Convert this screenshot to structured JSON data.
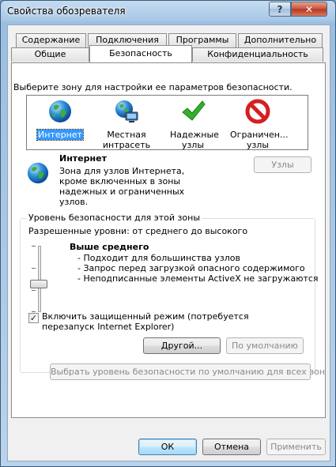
{
  "window": {
    "title": "Свойства обозревателя",
    "help_glyph": "?",
    "close_glyph": "✕"
  },
  "tabs": [
    {
      "label": "Содержание"
    },
    {
      "label": "Подключения"
    },
    {
      "label": "Программы"
    },
    {
      "label": "Дополнительно"
    },
    {
      "label": "Общие"
    },
    {
      "label": "Безопасность",
      "active": true
    },
    {
      "label": "Конфиденциальность"
    }
  ],
  "security": {
    "zone_prompt": "Выберите зону для настройки ее параметров безопасности.",
    "zones": [
      {
        "label": "Интернет",
        "icon": "globe-icon",
        "selected": true
      },
      {
        "label": "Местная интрасеть",
        "icon": "intranet-icon"
      },
      {
        "label": "Надежные узлы",
        "icon": "checkmark-icon"
      },
      {
        "label": "Ограничен... узлы",
        "icon": "restricted-icon"
      }
    ],
    "zone_name": "Интернет",
    "zone_description": "Зона для узлов Интернета, кроме включенных в зоны надежных и ограниченных узлов.",
    "sites_button": "Узлы",
    "level_group_title": "Уровень безопасности для этой зоны",
    "allowed_levels": "Разрешенные уровни: от среднего до высокого",
    "level_name": "Выше среднего",
    "level_bullets": [
      "- Подходит для большинства узлов",
      "- Запрос перед загрузкой опасного содержимого",
      "- Неподписанные элементы ActiveX не загружаются"
    ],
    "slider_level_fraction": 0.58,
    "protected_mode_label": "Включить защищенный режим (потребуется перезапуск Internet Explorer)",
    "protected_mode_checked": true,
    "custom_button": "Другой...",
    "default_button": "По умолчанию",
    "reset_all_button": "Выбрать уровень безопасности по умолчанию для всех зон"
  },
  "footer": {
    "ok": "ОК",
    "cancel": "Отмена",
    "apply": "Применить"
  }
}
